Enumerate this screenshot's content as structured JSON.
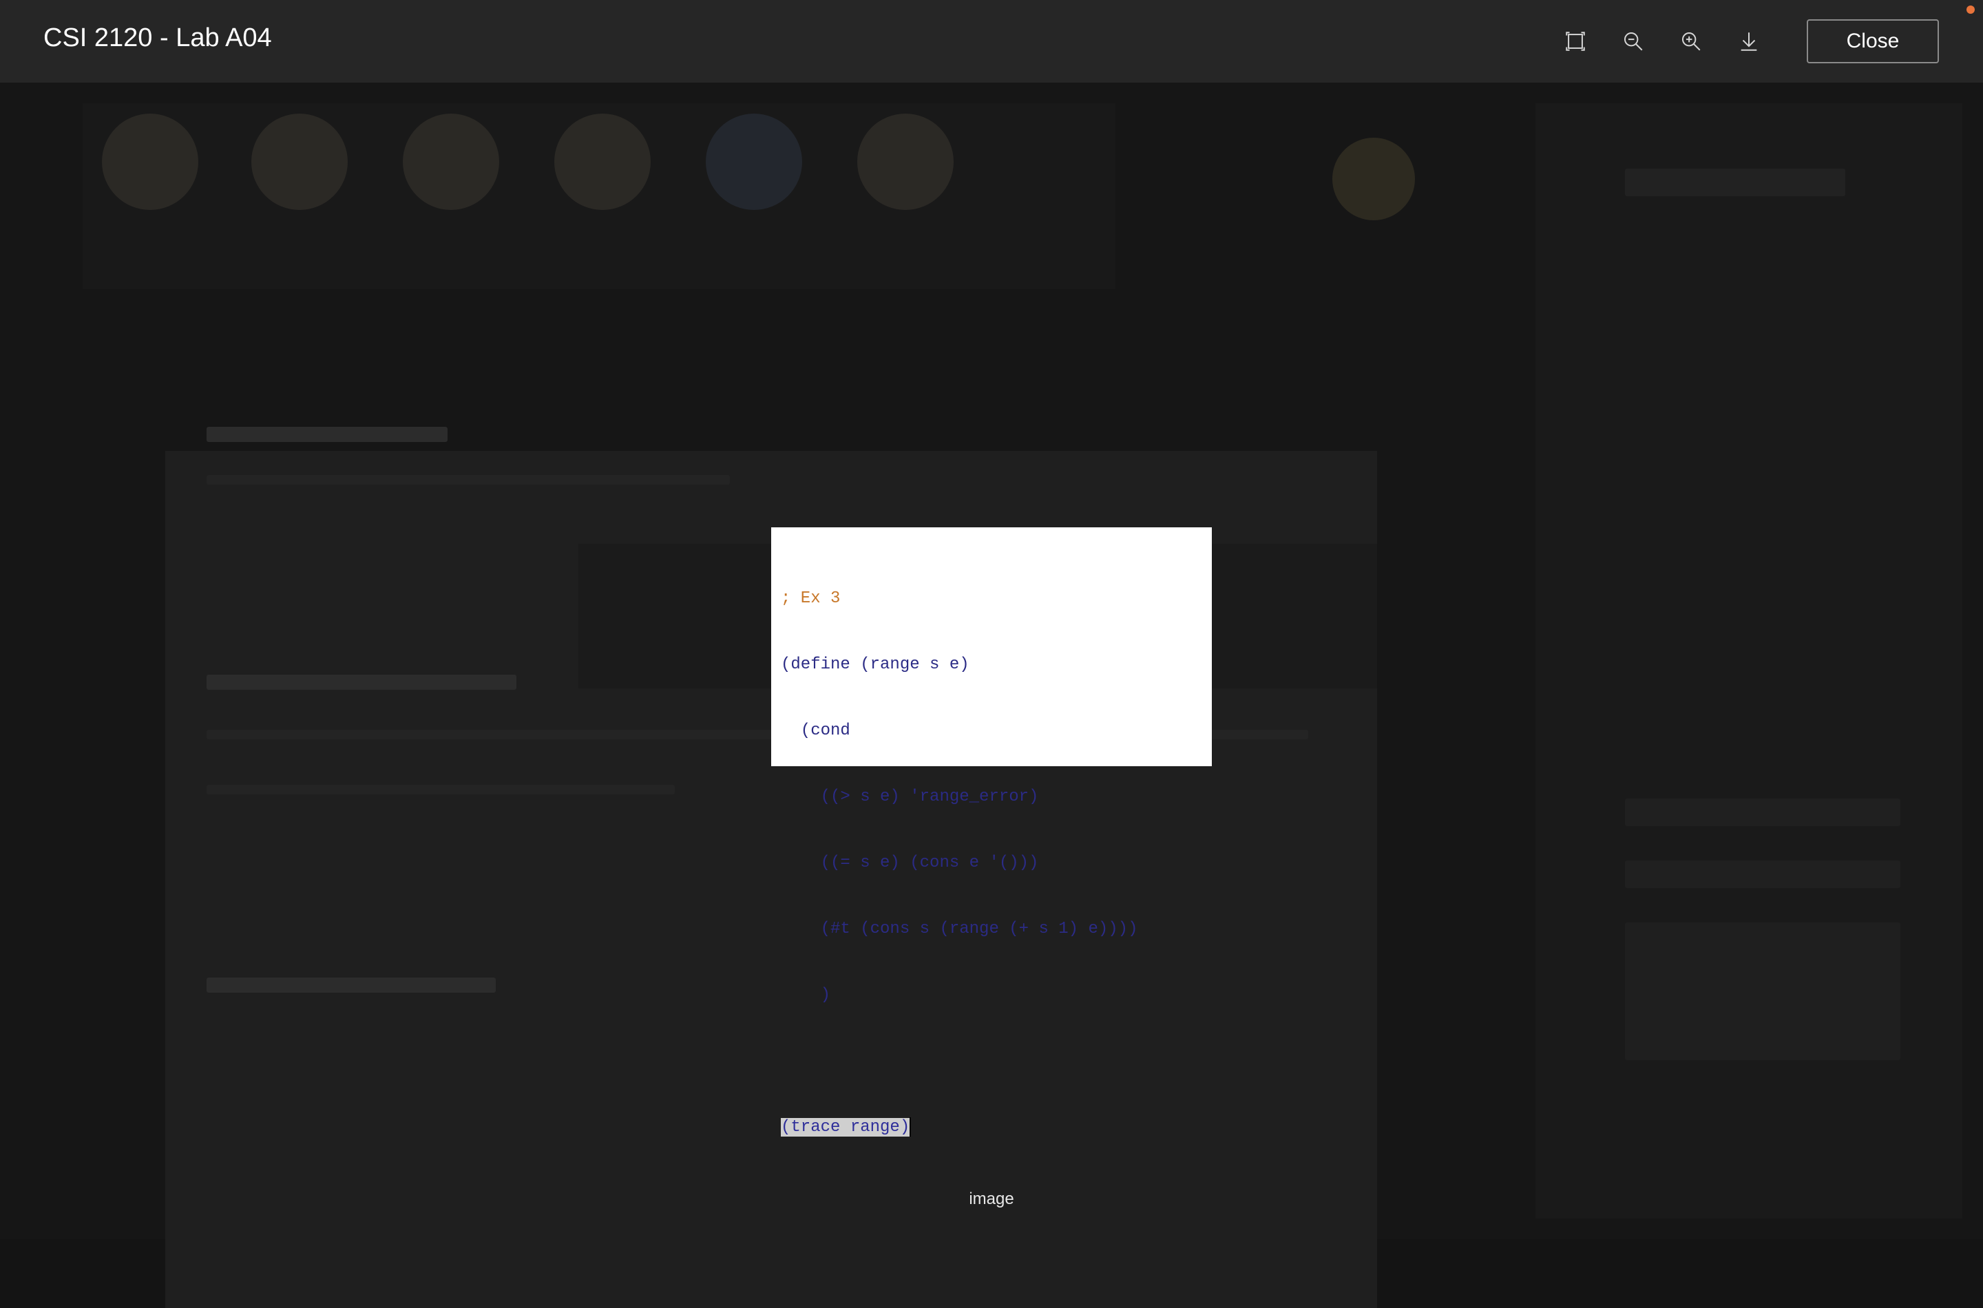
{
  "toolbar": {
    "title": "CSI 2120 - Lab A04",
    "close_label": "Close",
    "icons": [
      "fit-screen-icon",
      "zoom-out-icon",
      "zoom-in-icon",
      "download-icon"
    ]
  },
  "image": {
    "caption": "image",
    "code_lines": [
      "; Ex 3",
      "(define (range s e)",
      "  (cond",
      "    ((> s e) 'range_error)",
      "    ((= s e) (cons e '()))",
      "    (#t (cons s (range (+ s 1) e))))",
      "    )",
      "",
      "(trace range)"
    ]
  },
  "colors": {
    "toolbar_bg": "#262626",
    "backdrop": "#141414",
    "accent_dot": "#e8743b"
  }
}
